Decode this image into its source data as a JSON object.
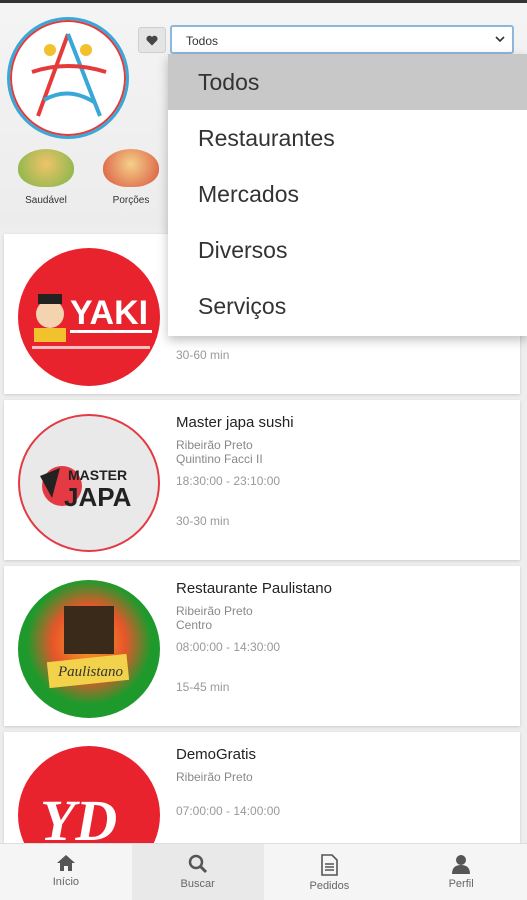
{
  "header": {
    "filter_select": {
      "value": "Todos"
    }
  },
  "categories": [
    {
      "label": "Saudável",
      "color": "#e8a54a"
    },
    {
      "label": "Porções",
      "color": "#d9533c"
    }
  ],
  "dropdown": {
    "options": [
      "Todos",
      "Restaurantes",
      "Mercados",
      "Diversos",
      "Serviços"
    ],
    "selected": "Todos"
  },
  "cards": [
    {
      "name": "",
      "city": "",
      "neighborhood": "",
      "hours": "",
      "eta": "30-60 min",
      "logo_text": "YAKI",
      "color": "#e8232e"
    },
    {
      "name": "Master japa sushi",
      "city": "Ribeirão Preto",
      "neighborhood": "Quintino Facci II",
      "hours": "18:30:00 - 23:10:00",
      "eta": "30-30 min",
      "logo_text": "MASTER JAPA",
      "color": "#e33a44"
    },
    {
      "name": "Restaurante Paulistano",
      "city": "Ribeirão Preto",
      "neighborhood": "Centro",
      "hours": "08:00:00 - 14:30:00",
      "eta": "15-45 min",
      "logo_text": "Paulistano",
      "color": "#1e9a2c"
    },
    {
      "name": "DemoGratis",
      "city": "Ribeirão Preto",
      "neighborhood": "",
      "hours": "07:00:00 - 14:00:00",
      "eta": "",
      "logo_text": "YD",
      "color": "#e8232e"
    }
  ],
  "bottom_nav": [
    {
      "label": "Início",
      "icon": "home-icon"
    },
    {
      "label": "Buscar",
      "icon": "search-icon"
    },
    {
      "label": "Pedidos",
      "icon": "document-icon"
    },
    {
      "label": "Perfil",
      "icon": "user-icon"
    }
  ]
}
